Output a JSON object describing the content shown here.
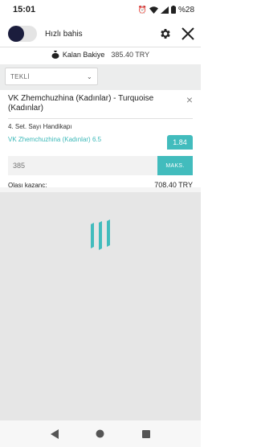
{
  "status_bar": {
    "time": "15:01",
    "battery": "%28",
    "icons": [
      "alarm-icon",
      "wifi-icon",
      "signal-icon",
      "battery-icon"
    ]
  },
  "topbar": {
    "quick_bet_label": "Hızlı bahis",
    "toggle_on": false,
    "icons": [
      "gear-icon",
      "close-icon"
    ]
  },
  "balance": {
    "label": "Kalan Bakiye",
    "amount": "385.40 TRY",
    "icon": "money-bag-icon"
  },
  "bet_type": {
    "selected": "TEKLİ"
  },
  "bet_slip": {
    "match": "VK Zhemchuzhina (Kadınlar) - Turquoise (Kadınlar)",
    "market": "4. Set. Sayı Handikapı",
    "selection": "VK Zhemchuzhina (Kadınlar) 6.5",
    "odds": "1.84",
    "stake_placeholder": "385",
    "max_label": "MAKS.",
    "potential_win_label": "Olası kazanç:",
    "potential_win_value": "708.40 TRY"
  },
  "colors": {
    "accent": "#42bcbd",
    "toggle_knob": "#1b1d3d",
    "background_gray": "#e6e6e6"
  }
}
